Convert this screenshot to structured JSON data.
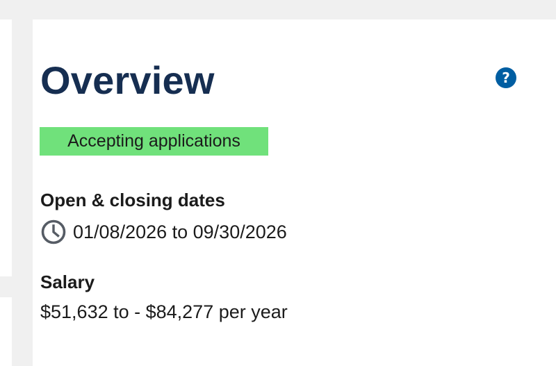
{
  "overview": {
    "title": "Overview",
    "help_icon": "question-icon",
    "help_symbol": "?",
    "status": "Accepting applications",
    "dates": {
      "heading": "Open & closing dates",
      "icon": "clock-icon",
      "value": "01/08/2026 to 09/30/2026"
    },
    "salary": {
      "heading": "Salary",
      "value": "$51,632 to - $84,277 per year"
    }
  },
  "colors": {
    "page_background": "#f0f0f0",
    "title": "#162e51",
    "help_icon": "#005ea2",
    "status_badge": "#70e17b",
    "body_text": "#1b1b1b",
    "clock_icon": "#565c65"
  }
}
